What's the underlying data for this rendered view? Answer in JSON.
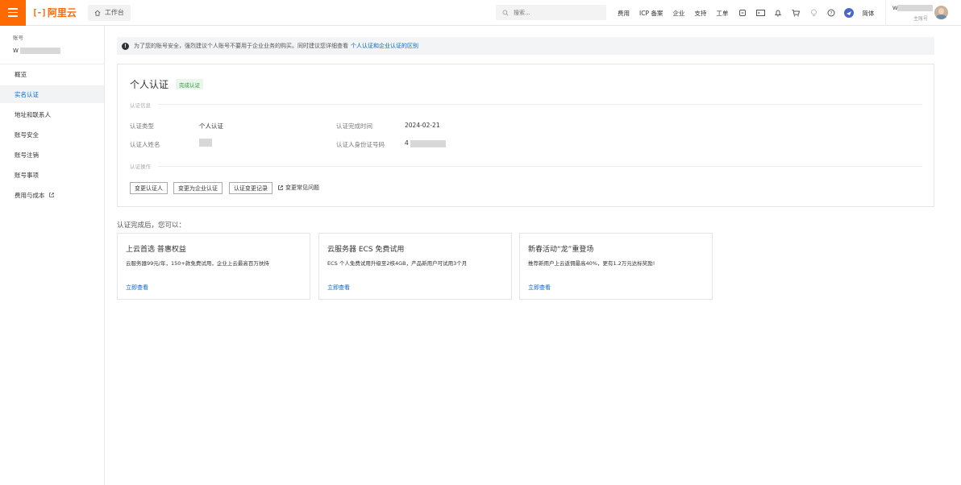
{
  "topbar": {
    "logo_mark": "[-]",
    "logo_text": "阿里云",
    "workbench": "工作台",
    "search_placeholder": "搜索...",
    "links": [
      "费用",
      "ICP 备案",
      "企业",
      "支持",
      "工单"
    ],
    "lang": "简体",
    "username_initial": "W",
    "role": "主账号"
  },
  "sidebar": {
    "account_label": "账号",
    "account_name_initial": "W",
    "items": [
      {
        "label": "概览"
      },
      {
        "label": "实名认证"
      },
      {
        "label": "地址和联系人"
      },
      {
        "label": "账号安全"
      },
      {
        "label": "账号注销"
      },
      {
        "label": "账号事项"
      },
      {
        "label": "费用与成本"
      }
    ]
  },
  "notice": {
    "text": "为了您的账号安全，强烈建议个人账号不要用于企业业务的购买。同时建议您详细查看",
    "link": "个人认证和企业认证的区别"
  },
  "card": {
    "title": "个人认证",
    "status_tag": "完成认证",
    "info_section": "认证信息",
    "fields": {
      "type_label": "认证类型",
      "type_value": "个人认证",
      "time_label": "认证完成时间",
      "time_value": "2024-02-21",
      "name_label": "认证人姓名",
      "id_label": "认证人身份证号码",
      "id_value_prefix": "4"
    },
    "ops_section": "认证操作",
    "buttons": [
      "变更认证人",
      "变更为企业认证",
      "认证变更记录"
    ],
    "faq_link": "变更常见问题"
  },
  "after": {
    "title": "认证完成后，您可以：",
    "promos": [
      {
        "title": "上云首选 普惠权益",
        "desc": "云服务器99元/年，150+款免费试用，企业上云最高百万扶持",
        "link": "立即查看"
      },
      {
        "title": "云服务器 ECS 免费试用",
        "desc": "ECS 个人免费试用升级至2核4GB，产品新用户可试用3个月",
        "link": "立即查看"
      },
      {
        "title": "新春活动“龙”重登场",
        "desc": "推荐新用户上云返佣最高40%，更有1.2万元达标奖励!",
        "link": "立即查看"
      }
    ]
  }
}
